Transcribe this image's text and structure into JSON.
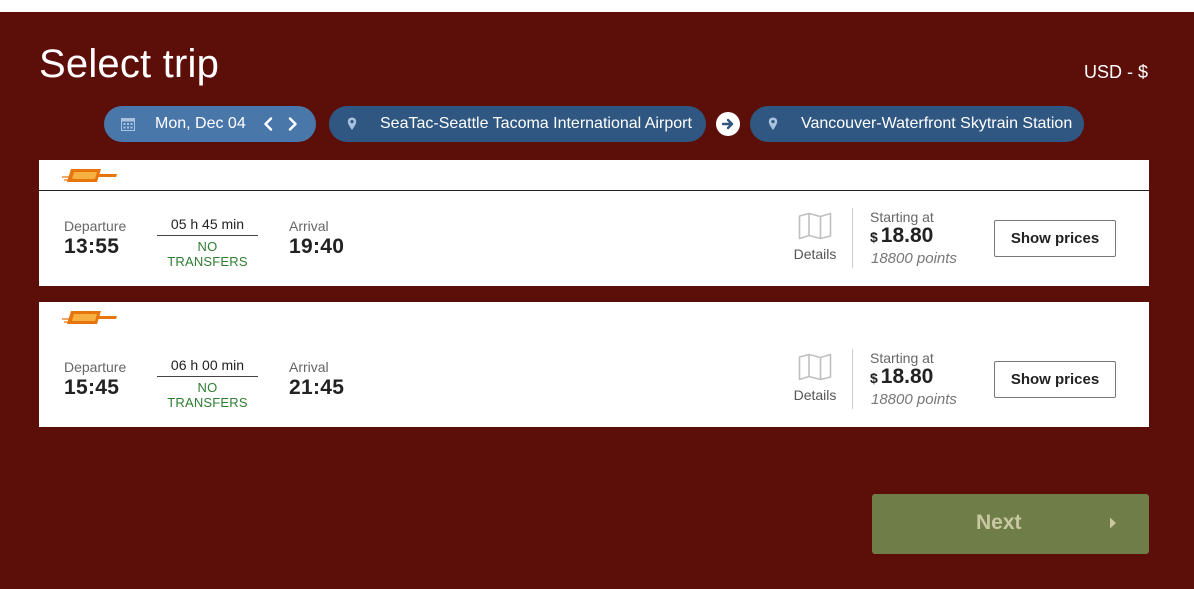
{
  "header": {
    "title": "Select trip",
    "currency": "USD - $"
  },
  "search": {
    "date": "Mon, Dec 04",
    "origin": "SeaTac-Seattle Tacoma International Airport",
    "destination": "Vancouver-Waterfront Skytrain Station"
  },
  "trips": [
    {
      "departure_label": "Departure",
      "departure_time": "13:55",
      "duration": "05 h 45 min",
      "transfers": "NO TRANSFERS",
      "arrival_label": "Arrival",
      "arrival_time": "19:40",
      "details_label": "Details",
      "starting_label": "Starting at",
      "currency_symbol": "$",
      "price": "18.80",
      "points": "18800 points",
      "show_prices_label": "Show prices"
    },
    {
      "departure_label": "Departure",
      "departure_time": "15:45",
      "duration": "06 h 00 min",
      "transfers": "NO TRANSFERS",
      "arrival_label": "Arrival",
      "arrival_time": "21:45",
      "details_label": "Details",
      "starting_label": "Starting at",
      "currency_symbol": "$",
      "price": "18.80",
      "points": "18800 points",
      "show_prices_label": "Show prices"
    }
  ],
  "footer": {
    "next_label": "Next"
  },
  "icons": {
    "date": "calendar-icon",
    "prev": "chevron-left-icon",
    "next": "chevron-right-icon",
    "location": "map-pin-icon",
    "direction": "arrow-right-circle-icon",
    "details": "map-icon",
    "carrier": "carrier-logo-icon",
    "next_button": "caret-right-icon"
  },
  "colors": {
    "background": "#5c0e09",
    "date_pill": "#4a77aa",
    "location_pill": "#2f5781",
    "transfers_text": "#2e7d32",
    "next_button": "#6f7e48",
    "logo": "#e8740c"
  }
}
